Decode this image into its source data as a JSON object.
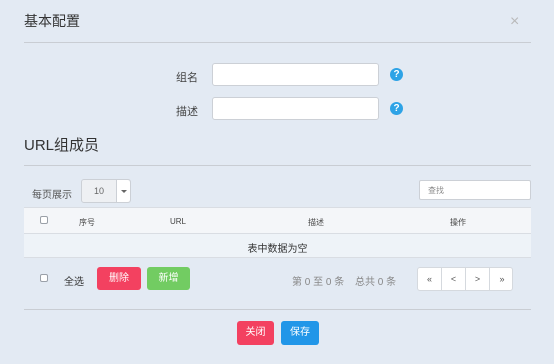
{
  "dialog": {
    "title": "基本配置",
    "close_glyph": "×"
  },
  "form": {
    "group_name_label": "组名",
    "description_label": "描述",
    "group_name_value": "",
    "description_value": "",
    "help_glyph": "?"
  },
  "members": {
    "section_title": "URL组成员",
    "page_size_label": "每页展示",
    "page_size_value": "10",
    "search_placeholder": "查找",
    "columns": [
      "序号",
      "URL",
      "描述",
      "操作"
    ],
    "empty_text": "表中数据为空",
    "select_all_label": "全选",
    "delete_label": "删除",
    "add_label": "新增",
    "page_info": "第 0 至 0 条",
    "total_info": "总共 0 条",
    "pager": [
      "«",
      "<",
      ">",
      "»"
    ]
  },
  "footer": {
    "close_label": "关闭",
    "save_label": "保存"
  },
  "colors": {
    "danger": "#f34160",
    "success": "#72cc62",
    "primary": "#2196e8",
    "help": "#2ea3e6"
  }
}
